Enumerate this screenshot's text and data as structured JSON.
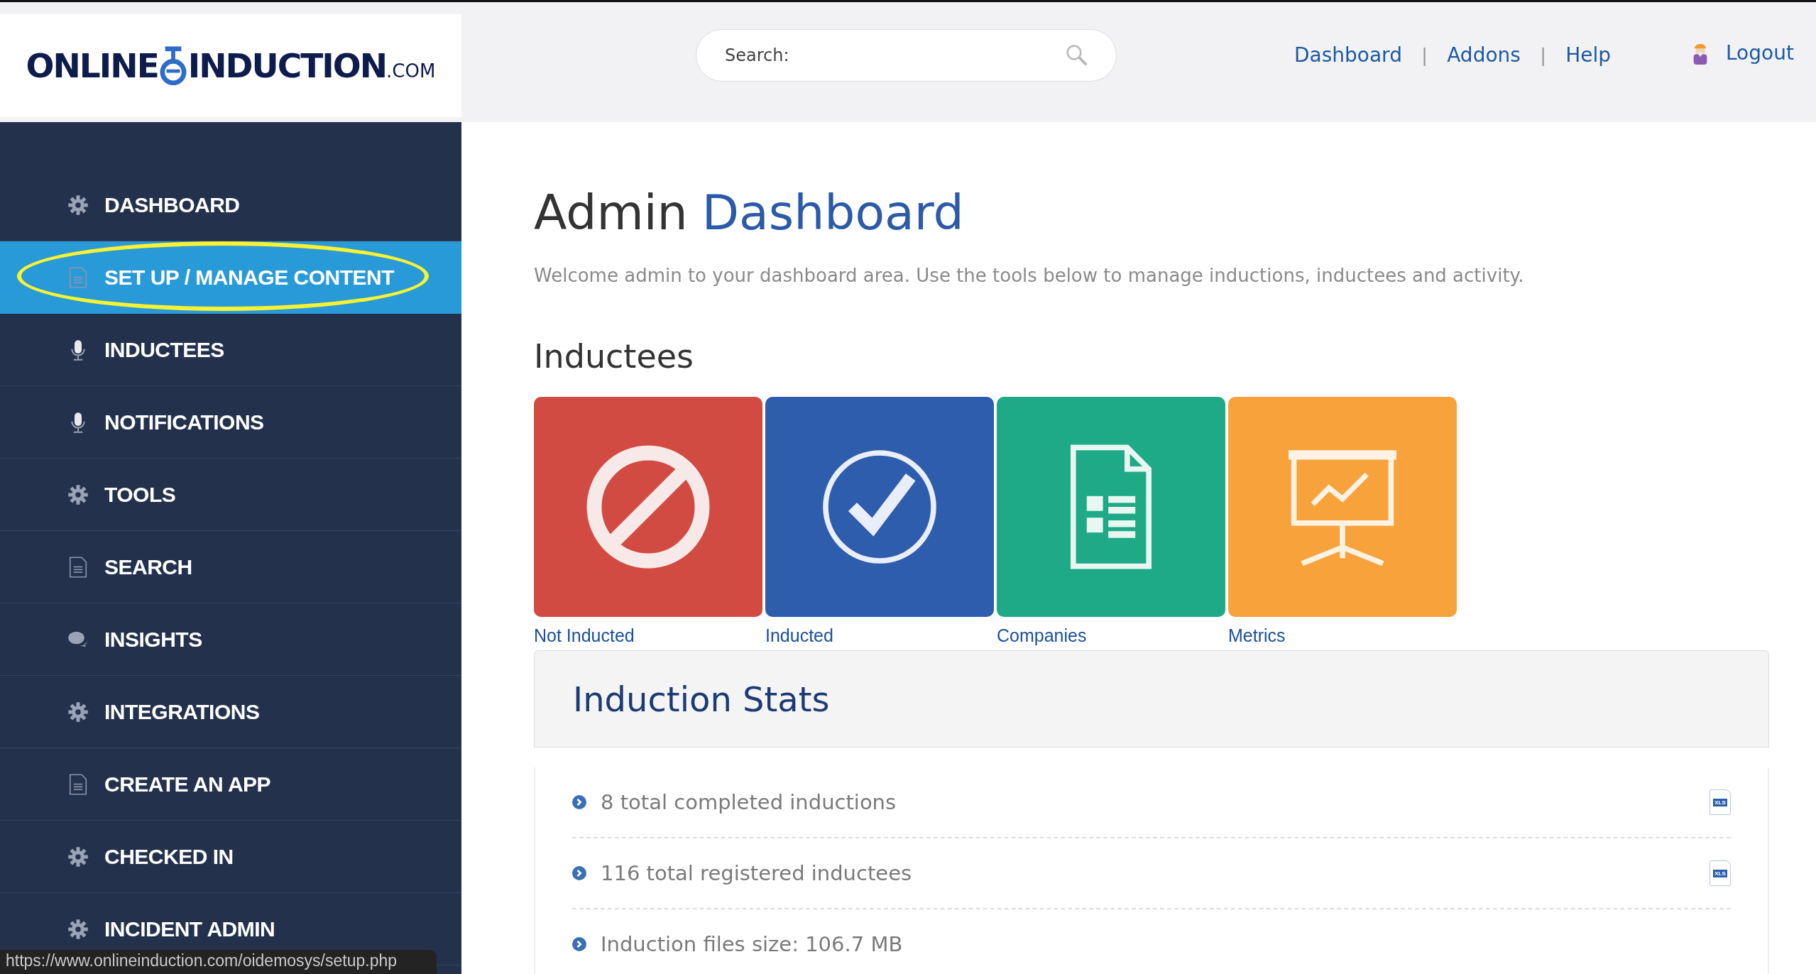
{
  "logo": {
    "left": "ONLINE",
    "right": "INDUCTION",
    "suffix": ".COM"
  },
  "search": {
    "placeholder": "Search:"
  },
  "nav_links": [
    {
      "label": "Dashboard"
    },
    {
      "label": "Addons"
    },
    {
      "label": "Help"
    }
  ],
  "nav_separator": "|",
  "logout": {
    "label": "Logout"
  },
  "sidebar": {
    "items": [
      {
        "label": "DASHBOARD",
        "kind": "gear",
        "selected": false,
        "circled": false
      },
      {
        "label": "SET UP / MANAGE CONTENT",
        "kind": "doc",
        "selected": true,
        "circled": true
      },
      {
        "label": "INDUCTEES",
        "kind": "mic",
        "selected": false,
        "circled": false
      },
      {
        "label": "NOTIFICATIONS",
        "kind": "mic",
        "selected": false,
        "circled": false
      },
      {
        "label": "TOOLS",
        "kind": "gear",
        "selected": false,
        "circled": false
      },
      {
        "label": "SEARCH",
        "kind": "doc",
        "selected": false,
        "circled": false
      },
      {
        "label": "INSIGHTS",
        "kind": "chat",
        "selected": false,
        "circled": false
      },
      {
        "label": "INTEGRATIONS",
        "kind": "gear",
        "selected": false,
        "circled": false
      },
      {
        "label": "CREATE AN APP",
        "kind": "doc",
        "selected": false,
        "circled": false
      },
      {
        "label": "CHECKED IN",
        "kind": "gear",
        "selected": false,
        "circled": false
      },
      {
        "label": "INCIDENT ADMIN",
        "kind": "gear",
        "selected": false,
        "circled": false
      }
    ]
  },
  "page": {
    "title_plain": "Admin",
    "title_accent": "Dashboard",
    "subtitle": "Welcome admin to your dashboard area. Use the tools below to manage inductions, inductees and activity."
  },
  "inductees": {
    "heading": "Inductees",
    "tiles": [
      {
        "label": "Not Inducted",
        "kind": "no",
        "color": "#d24b43"
      },
      {
        "label": "Inducted",
        "kind": "check",
        "color": "#2f5dae"
      },
      {
        "label": "Companies",
        "kind": "sheet",
        "color": "#1eaa86"
      },
      {
        "label": "Metrics",
        "kind": "board",
        "color": "#f7a23a"
      }
    ]
  },
  "stats": {
    "heading": "Induction Stats",
    "rows": [
      {
        "text": "8 total completed inductions",
        "file_label": "XLS"
      },
      {
        "text": "116 total registered inductees",
        "file_label": "XLS"
      },
      {
        "text": "Induction files size: 106.7 MB"
      }
    ]
  },
  "status_bar": {
    "url": "https://www.onlineinduction.com/oidemosys/setup.php"
  }
}
